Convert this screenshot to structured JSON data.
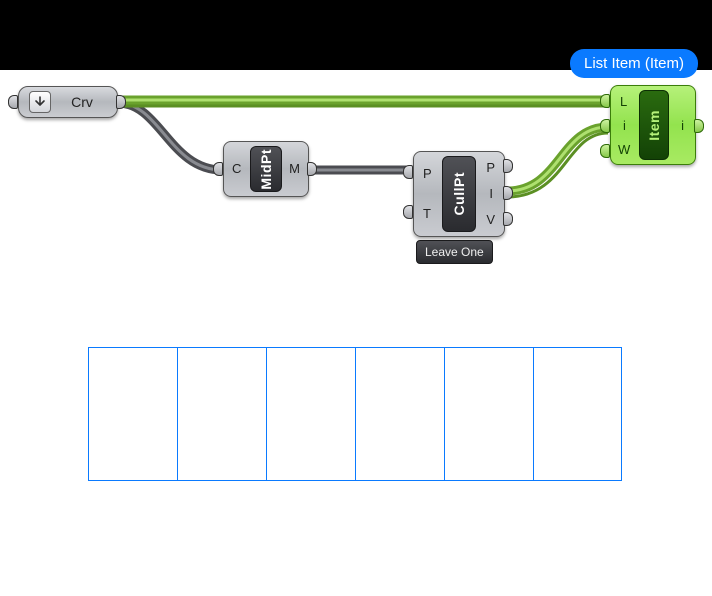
{
  "tooltip": {
    "text": "List Item (Item)"
  },
  "crv_param": {
    "label": "Crv",
    "icon_name": "arrow-down-icon"
  },
  "midpt": {
    "core_label": "MidPt",
    "inputs": [
      "C"
    ],
    "outputs": [
      "M"
    ]
  },
  "cullpt": {
    "core_label": "CullPt",
    "inputs": [
      "P",
      "T"
    ],
    "outputs": [
      "P",
      "I",
      "V"
    ],
    "nickname": "Leave One"
  },
  "item": {
    "core_label": "Item",
    "inputs": [
      "L",
      "i",
      "W"
    ],
    "outputs": [
      "i"
    ]
  }
}
